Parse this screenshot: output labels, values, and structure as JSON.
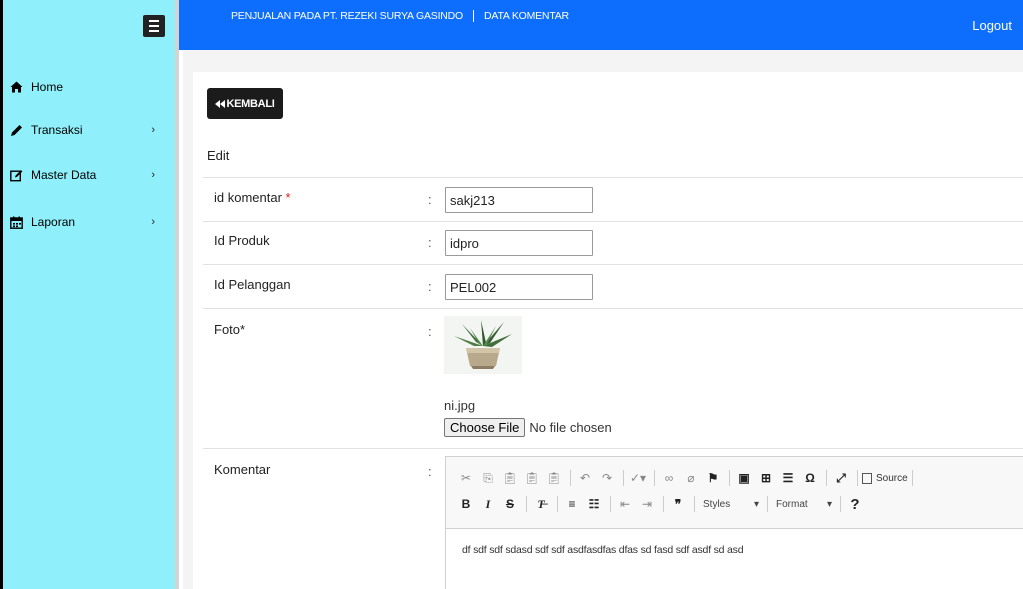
{
  "topbar": {
    "app_title": "PENJUALAN PADA PT. REZEKI SURYA GASINDO",
    "page_title": "DATA KOMENTAR",
    "logout_label": "Logout"
  },
  "sidebar": {
    "items": [
      {
        "label": "Home",
        "icon": "home-icon"
      },
      {
        "label": "Transaksi",
        "icon": "pencil-icon",
        "chevron": "›"
      },
      {
        "label": "Master Data",
        "icon": "edit-icon",
        "chevron": "›"
      },
      {
        "label": "Laporan",
        "icon": "calendar-icon",
        "chevron": "›"
      }
    ]
  },
  "main": {
    "back_label": "KEMBALI",
    "form_title": "Edit",
    "fields": {
      "id_komentar": {
        "label": "id komentar",
        "required_mark": "*",
        "value": "sakj213"
      },
      "id_produk": {
        "label": "Id Produk",
        "value": "idpro"
      },
      "id_pelanggan": {
        "label": "Id Pelanggan",
        "value": "PEL002"
      },
      "foto": {
        "label": "Foto*",
        "filename": "ni.jpg",
        "choose_label": "Choose File",
        "no_file": "No file chosen"
      },
      "komentar": {
        "label": "Komentar",
        "toolbar": {
          "styles": "Styles",
          "format": "Format",
          "source": "Source",
          "help": "?"
        },
        "text": "df sdf sdf sdasd sdf sdf asdfasdfas dfas sd fasd sdf asdf sd asd"
      }
    },
    "colon": ":"
  },
  "colors": {
    "topbar": "#0d6efd",
    "sidebar": "#8ff0fb",
    "back_button": "#1b1b1b"
  }
}
